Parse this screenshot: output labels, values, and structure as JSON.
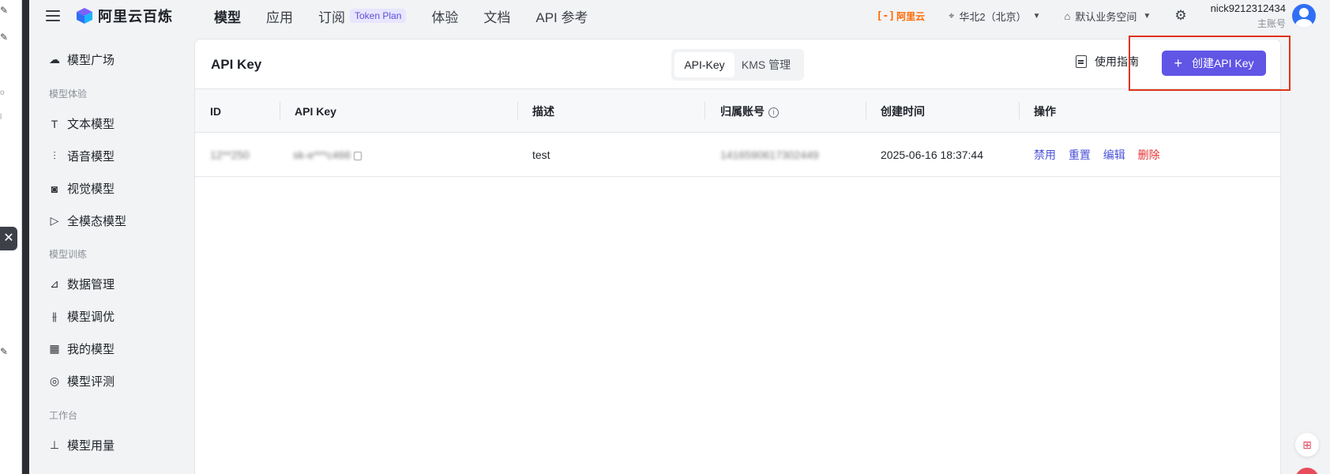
{
  "app": {
    "brand": "阿里云百炼",
    "nav": [
      {
        "label": "模型",
        "active": true
      },
      {
        "label": "应用"
      },
      {
        "label": "订阅",
        "badge": "Token Plan"
      },
      {
        "label": "体验"
      },
      {
        "label": "文档"
      },
      {
        "label": "API 参考"
      }
    ],
    "aliyun_logo": "阿里云",
    "region": "华北2（北京）",
    "workspace": "默认业务空间",
    "user": {
      "name": "nick9212312434",
      "role": "主账号"
    }
  },
  "sidebar": {
    "items": [
      {
        "label": "模型广场",
        "icon": "cloud-icon"
      },
      {
        "group": "模型体验"
      },
      {
        "label": "文本模型",
        "icon": "text-icon"
      },
      {
        "label": "语音模型",
        "icon": "waveform-icon"
      },
      {
        "label": "视觉模型",
        "icon": "camera-icon"
      },
      {
        "label": "全模态模型",
        "icon": "play-icon"
      },
      {
        "group": "模型训练"
      },
      {
        "label": "数据管理",
        "icon": "chart-icon"
      },
      {
        "label": "模型调优",
        "icon": "sliders-icon"
      },
      {
        "label": "我的模型",
        "icon": "grid-icon"
      },
      {
        "label": "模型评测",
        "icon": "compass-icon"
      },
      {
        "group": "工作台"
      },
      {
        "label": "模型用量",
        "icon": "usage-icon"
      }
    ]
  },
  "page": {
    "title": "API Key",
    "tabs": [
      {
        "label": "API-Key",
        "selected": true
      },
      {
        "label": "KMS 管理"
      }
    ],
    "guide_label": "使用指南",
    "create_label": "创建API Key"
  },
  "table": {
    "columns": [
      "ID",
      "API Key",
      "描述",
      "归属账号",
      "创建时间",
      "操作"
    ],
    "rows": [
      {
        "id": "12**250",
        "api_key": "sk-e***c466",
        "description": "test",
        "account": "1416590617302449",
        "created": "2025-06-16 18:37:44",
        "actions": [
          "禁用",
          "重置",
          "编辑",
          "删除"
        ]
      }
    ]
  },
  "colors": {
    "primary": "#6155e6",
    "danger": "#e5302f",
    "link": "#4a52d8",
    "aliyun_orange": "#ff6a00",
    "highlight_box": "#e0331b"
  }
}
